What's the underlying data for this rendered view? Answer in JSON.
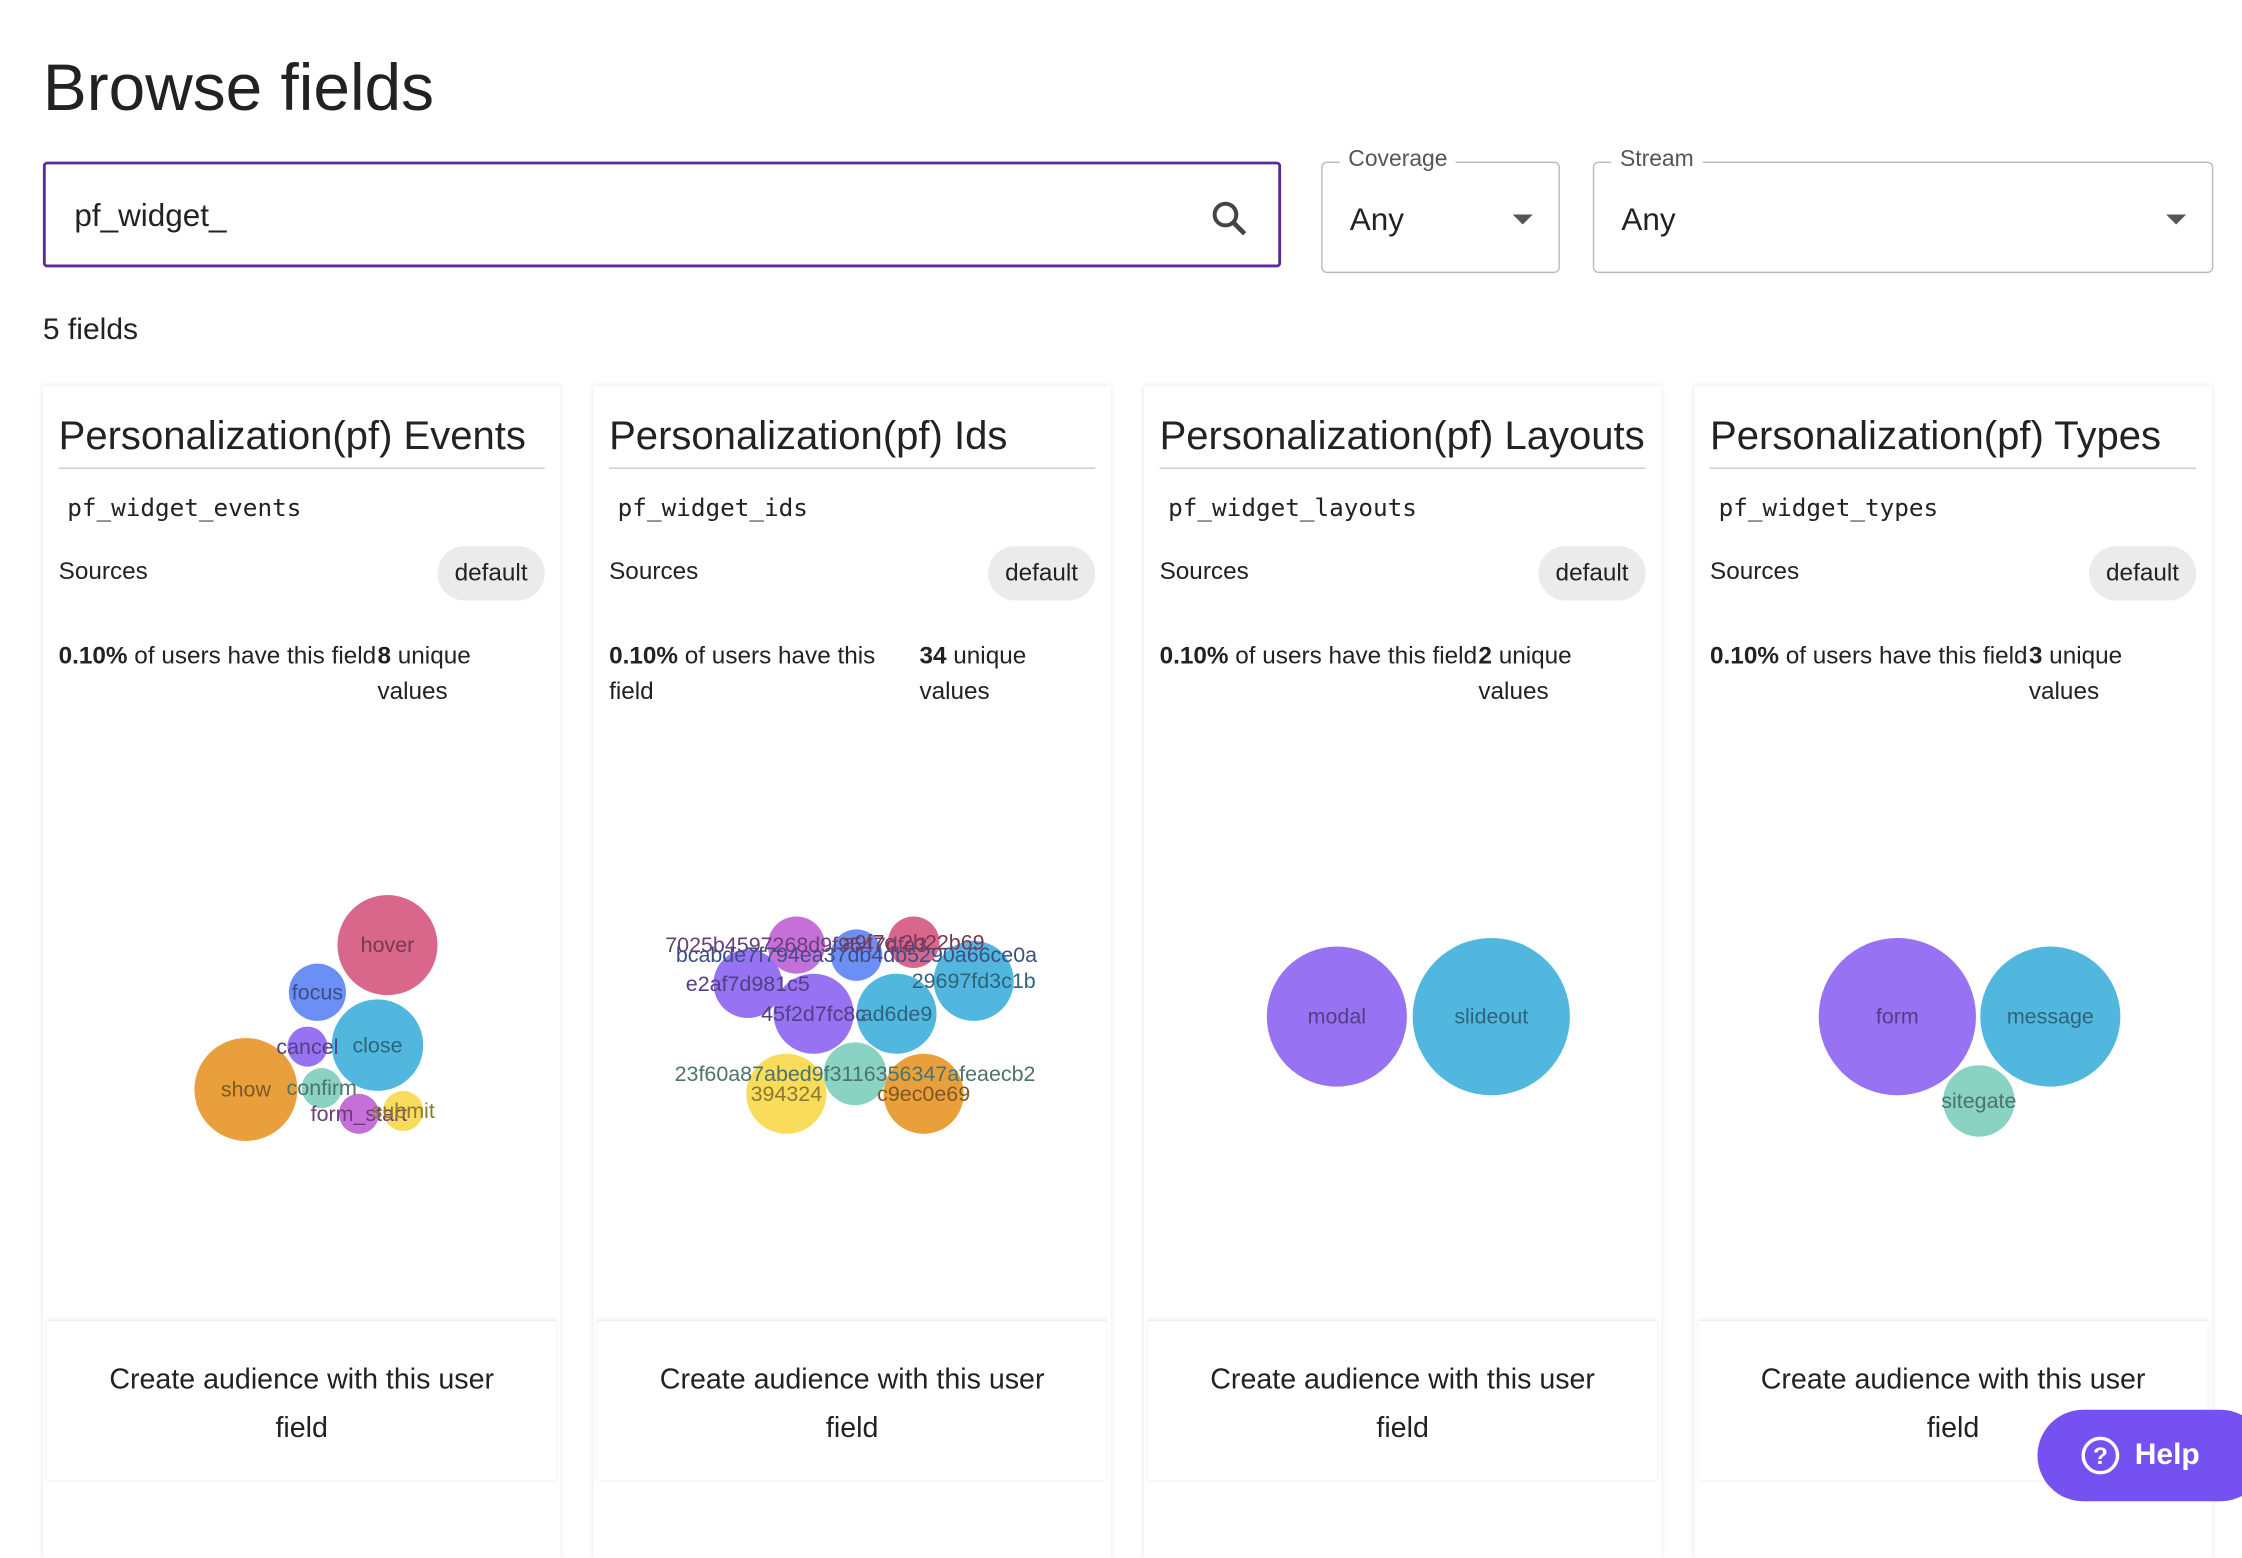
{
  "page_title": "Browse fields",
  "search": {
    "value": "pf_widget_"
  },
  "filters": [
    {
      "label": "Coverage",
      "value": "Any"
    },
    {
      "label": "Stream",
      "value": "Any"
    }
  ],
  "result_count": "5 fields",
  "sources_label": "Sources",
  "source_badge": "default",
  "coverage_suffix": "of users have this field",
  "unique_suffix": "unique values",
  "cta_label": "Create audience with this user field",
  "help_label": "Help",
  "colors": {
    "accent": "#7551f2",
    "search_border": "#5b2a9a"
  },
  "cards": [
    {
      "title": "Personalization(pf) Events",
      "field": "pf_widget_events",
      "coverage": "0.10%",
      "unique": "8",
      "bubbles": [
        {
          "label": "hover",
          "color": "#d9678c"
        },
        {
          "label": "focus",
          "color": "#6b8ff5"
        },
        {
          "label": "close",
          "color": "#52b7df"
        },
        {
          "label": "cancel",
          "color": "#9772f2"
        },
        {
          "label": "show",
          "color": "#e9a03c"
        },
        {
          "label": "confirm",
          "color": "#8ad3c2"
        },
        {
          "label": "form_start",
          "color": "#c570d8"
        },
        {
          "label": "submit",
          "color": "#f9dc5c"
        }
      ]
    },
    {
      "title": "Personalization(pf) Ids",
      "field": "pf_widget_ids",
      "coverage": "0.10%",
      "unique": "34",
      "bubbles": [
        {
          "label": "7025b4597268d9f9547dfa3",
          "color": "#c570d8"
        },
        {
          "label": "bcabde7f794ea37db4db5290a66ce0a",
          "color": "#6b8ff5"
        },
        {
          "label": "a9f7c 2b22b69",
          "color": "#d9678c"
        },
        {
          "label": "e2af7d981c5",
          "color": "#9772f2"
        },
        {
          "label": "29697fd3c1b",
          "color": "#52b7df"
        },
        {
          "label": "45f2d7fc8c",
          "color": "#9772f2"
        },
        {
          "label": "ad6de9",
          "color": "#52b7df"
        },
        {
          "label": "23f60a87abed9f3116356347afeaecb2",
          "color": "#8ad3c2"
        },
        {
          "label": "394324",
          "color": "#f9dc5c"
        },
        {
          "label": "c9ec0e69",
          "color": "#e9a03c"
        }
      ]
    },
    {
      "title": "Personalization(pf) Layouts",
      "field": "pf_widget_layouts",
      "coverage": "0.10%",
      "unique": "2",
      "bubbles": [
        {
          "label": "modal",
          "color": "#9772f2"
        },
        {
          "label": "slideout",
          "color": "#52b7df"
        }
      ]
    },
    {
      "title": "Personalization(pf) Types",
      "field": "pf_widget_types",
      "coverage": "0.10%",
      "unique": "3",
      "bubbles": [
        {
          "label": "form",
          "color": "#9772f2"
        },
        {
          "label": "message",
          "color": "#52b7df"
        },
        {
          "label": "sitegate",
          "color": "#8ad3c2"
        }
      ]
    }
  ]
}
